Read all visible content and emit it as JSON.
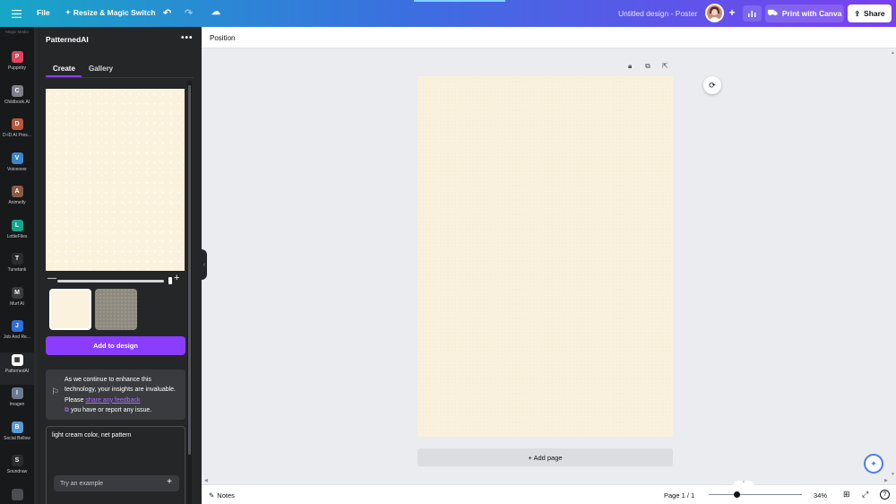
{
  "topbar": {
    "file_label": "File",
    "resize_label": "Resize & Magic Switch",
    "design_title": "Untitled design - Poster",
    "print_label": "Print with Canva",
    "share_label": "Share"
  },
  "rail": {
    "top_label": "Magic Media",
    "apps": [
      {
        "label": "Puppetry",
        "color": "#e0455c",
        "glyph": "P"
      },
      {
        "label": "Childbook.AI",
        "color": "#7d8088",
        "glyph": "C"
      },
      {
        "label": "D-ID AI Pres...",
        "color": "#b5573f",
        "glyph": "D"
      },
      {
        "label": "Voiceover",
        "color": "#3a86c8",
        "glyph": "V"
      },
      {
        "label": "Animeify",
        "color": "#8a5a44",
        "glyph": "A"
      },
      {
        "label": "LottieFiles",
        "color": "#11a88a",
        "glyph": "L"
      },
      {
        "label": "Tunetank",
        "color": "#2b2c30",
        "glyph": "T"
      },
      {
        "label": "Murf AI",
        "color": "#3b3c40",
        "glyph": "M"
      },
      {
        "label": "Job And Re...",
        "color": "#2f6fd8",
        "glyph": "J"
      },
      {
        "label": "PatternedAI",
        "color": "#ffffff",
        "glyph": "▦"
      },
      {
        "label": "Imagen",
        "color": "#6c7a8f",
        "glyph": "I"
      },
      {
        "label": "Social Bellow",
        "color": "#5a9ad6",
        "glyph": "B"
      },
      {
        "label": "Soundraw",
        "color": "#2b2c30",
        "glyph": "S"
      },
      {
        "label": "",
        "color": "#4b4d52",
        "glyph": ""
      }
    ]
  },
  "panel": {
    "title": "PatternedAI",
    "tabs": [
      "Create",
      "Gallery"
    ],
    "add_button": "Add to design",
    "feedback_before": "As we continue to enhance this technology, your insights are invaluable. Please ",
    "feedback_link": "share any feedback",
    "feedback_after": " you have or report any issue.",
    "prompt_text": "light cream color, net pattern",
    "example_label": "Try an example"
  },
  "canvas": {
    "position_label": "Position",
    "add_page_label": "+ Add page"
  },
  "bottom": {
    "notes_label": "Notes",
    "page_label": "Page 1 / 1",
    "zoom_label": "34%",
    "zoom_level_percent": 34,
    "help_label": "?"
  },
  "colors": {
    "accent": "#8b3dff",
    "page_bg": "#f9f1dd"
  }
}
